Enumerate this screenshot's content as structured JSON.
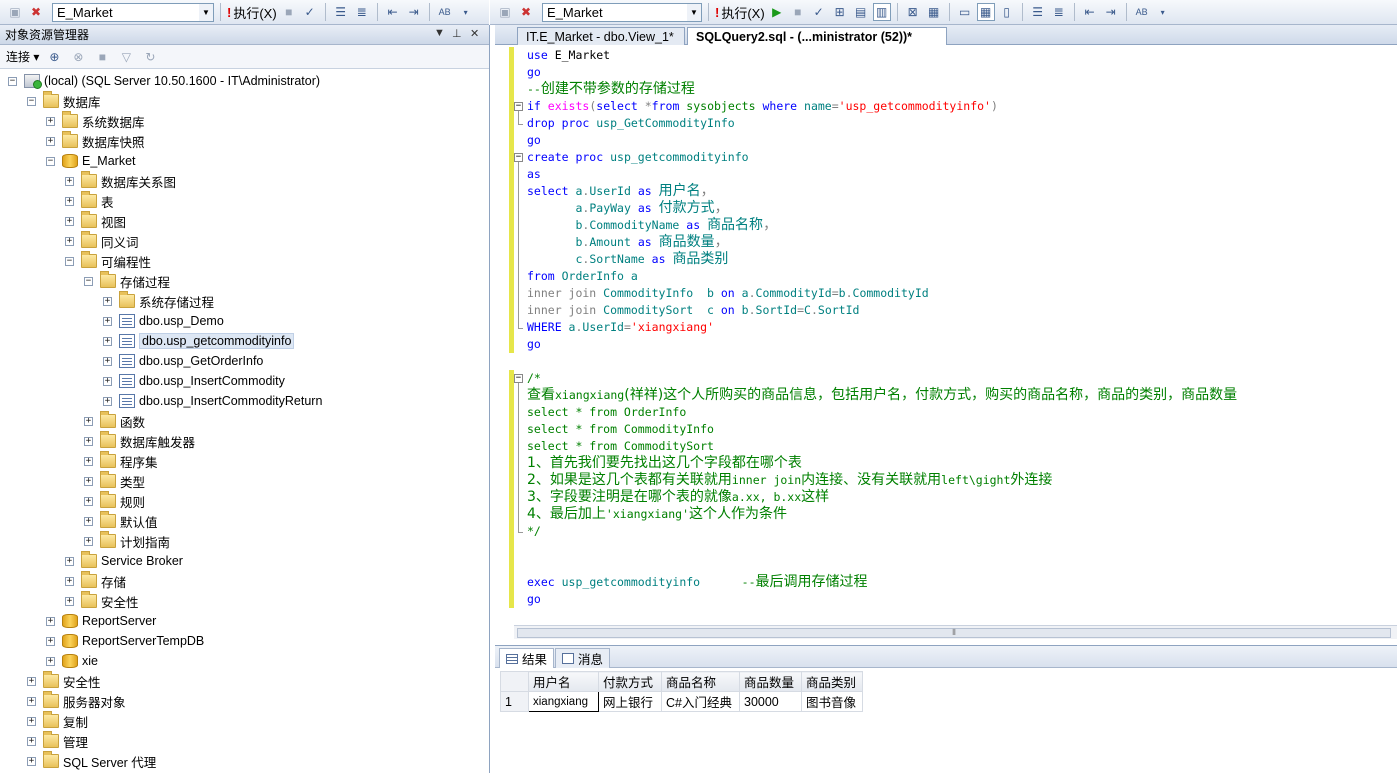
{
  "toolbar_left": {
    "database": "E_Market",
    "execute_label": "执行(X)"
  },
  "toolbar_right": {
    "database": "E_Market",
    "execute_label": "执行(X)"
  },
  "object_explorer": {
    "title": "对象资源管理器",
    "connect_label": "连接",
    "tree": [
      {
        "label": "(local) (SQL Server 10.50.1600 - IT\\Administrator)",
        "level": 0,
        "icon": "server-icon",
        "expanded": true
      },
      {
        "label": "数据库",
        "level": 1,
        "icon": "folder-icon",
        "expanded": true
      },
      {
        "label": "系统数据库",
        "level": 2,
        "icon": "folder-icon",
        "expanded": false
      },
      {
        "label": "数据库快照",
        "level": 2,
        "icon": "folder-icon",
        "expanded": false
      },
      {
        "label": "E_Market",
        "level": 2,
        "icon": "database-icon",
        "expanded": true
      },
      {
        "label": "数据库关系图",
        "level": 3,
        "icon": "folder-icon",
        "expanded": false
      },
      {
        "label": "表",
        "level": 3,
        "icon": "folder-icon",
        "expanded": false
      },
      {
        "label": "视图",
        "level": 3,
        "icon": "folder-icon",
        "expanded": false
      },
      {
        "label": "同义词",
        "level": 3,
        "icon": "folder-icon",
        "expanded": false
      },
      {
        "label": "可编程性",
        "level": 3,
        "icon": "folder-icon",
        "expanded": true
      },
      {
        "label": "存储过程",
        "level": 4,
        "icon": "folder-icon",
        "expanded": true
      },
      {
        "label": "系统存储过程",
        "level": 5,
        "icon": "folder-icon",
        "expanded": false
      },
      {
        "label": "dbo.usp_Demo",
        "level": 5,
        "icon": "procedure-icon",
        "expanded": false
      },
      {
        "label": "dbo.usp_getcommodityinfo",
        "level": 5,
        "icon": "procedure-icon",
        "expanded": false,
        "selected": true
      },
      {
        "label": "dbo.usp_GetOrderInfo",
        "level": 5,
        "icon": "procedure-icon",
        "expanded": false
      },
      {
        "label": "dbo.usp_InsertCommodity",
        "level": 5,
        "icon": "procedure-icon",
        "expanded": false
      },
      {
        "label": "dbo.usp_InsertCommodityReturn",
        "level": 5,
        "icon": "procedure-icon",
        "expanded": false
      },
      {
        "label": "函数",
        "level": 4,
        "icon": "folder-icon",
        "expanded": false
      },
      {
        "label": "数据库触发器",
        "level": 4,
        "icon": "folder-icon",
        "expanded": false
      },
      {
        "label": "程序集",
        "level": 4,
        "icon": "folder-icon",
        "expanded": false
      },
      {
        "label": "类型",
        "level": 4,
        "icon": "folder-icon",
        "expanded": false
      },
      {
        "label": "规则",
        "level": 4,
        "icon": "folder-icon",
        "expanded": false
      },
      {
        "label": "默认值",
        "level": 4,
        "icon": "folder-icon",
        "expanded": false
      },
      {
        "label": "计划指南",
        "level": 4,
        "icon": "folder-icon",
        "expanded": false
      },
      {
        "label": "Service Broker",
        "level": 3,
        "icon": "folder-icon",
        "expanded": false
      },
      {
        "label": "存储",
        "level": 3,
        "icon": "folder-icon",
        "expanded": false
      },
      {
        "label": "安全性",
        "level": 3,
        "icon": "folder-icon",
        "expanded": false
      },
      {
        "label": "ReportServer",
        "level": 2,
        "icon": "database-icon",
        "expanded": false
      },
      {
        "label": "ReportServerTempDB",
        "level": 2,
        "icon": "database-icon",
        "expanded": false
      },
      {
        "label": "xie",
        "level": 2,
        "icon": "database-icon",
        "expanded": false
      },
      {
        "label": "安全性",
        "level": 1,
        "icon": "folder-icon",
        "expanded": false
      },
      {
        "label": "服务器对象",
        "level": 1,
        "icon": "folder-icon",
        "expanded": false
      },
      {
        "label": "复制",
        "level": 1,
        "icon": "folder-icon",
        "expanded": false
      },
      {
        "label": "管理",
        "level": 1,
        "icon": "folder-icon",
        "expanded": false
      },
      {
        "label": "SQL Server 代理",
        "level": 1,
        "icon": "folder-icon",
        "expanded": false
      }
    ]
  },
  "editor": {
    "tabs": [
      {
        "label": "IT.E_Market - dbo.View_1*",
        "active": false
      },
      {
        "label": "SQLQuery2.sql - (...ministrator (52))*",
        "active": true
      }
    ],
    "lines": [
      {
        "fold": "",
        "parts": [
          [
            "kw",
            "use "
          ],
          [
            "",
            "E_Market"
          ]
        ]
      },
      {
        "fold": "",
        "parts": [
          [
            "kw",
            "go"
          ]
        ]
      },
      {
        "fold": "",
        "parts": [
          [
            "cm",
            "--"
          ],
          [
            "cm cn",
            "创建不带参数的存储过程"
          ]
        ]
      },
      {
        "fold": "minus",
        "parts": [
          [
            "kw",
            "if "
          ],
          [
            "fn",
            "exists"
          ],
          [
            "gr",
            "("
          ],
          [
            "kw",
            "select "
          ],
          [
            "gr",
            "*"
          ],
          [
            "kw",
            "from "
          ],
          [
            "sys",
            "sysobjects "
          ],
          [
            "kw",
            "where "
          ],
          [
            "tl",
            "name"
          ],
          [
            "gr",
            "="
          ],
          [
            "str",
            "'usp_getcommodityinfo'"
          ],
          [
            "gr",
            ")"
          ]
        ]
      },
      {
        "fold": "end",
        "parts": [
          [
            "kw",
            "drop proc "
          ],
          [
            "tl",
            "usp_GetCommodityInfo"
          ]
        ]
      },
      {
        "fold": "",
        "parts": [
          [
            "kw",
            "go"
          ]
        ]
      },
      {
        "fold": "minus",
        "parts": [
          [
            "kw",
            "create proc "
          ],
          [
            "tl",
            "usp_getcommodityinfo"
          ]
        ]
      },
      {
        "fold": "",
        "parts": [
          [
            "kw",
            "as"
          ]
        ]
      },
      {
        "fold": "",
        "parts": [
          [
            "kw",
            "select "
          ],
          [
            "tl",
            "a"
          ],
          [
            "gr",
            "."
          ],
          [
            "tl",
            "UserId "
          ],
          [
            "kw",
            "as "
          ],
          [
            "tl cn",
            "用户名"
          ],
          [
            "gr cn",
            "，"
          ]
        ]
      },
      {
        "fold": "",
        "parts": [
          [
            "",
            "       "
          ],
          [
            "tl",
            "a"
          ],
          [
            "gr",
            "."
          ],
          [
            "tl",
            "PayWay "
          ],
          [
            "kw",
            "as "
          ],
          [
            "tl cn",
            "付款方式"
          ],
          [
            "gr cn",
            "，"
          ]
        ]
      },
      {
        "fold": "",
        "parts": [
          [
            "",
            "       "
          ],
          [
            "tl",
            "b"
          ],
          [
            "gr",
            "."
          ],
          [
            "tl",
            "CommodityName "
          ],
          [
            "kw",
            "as "
          ],
          [
            "tl cn",
            "商品名称"
          ],
          [
            "gr cn",
            "，"
          ]
        ]
      },
      {
        "fold": "",
        "parts": [
          [
            "",
            "       "
          ],
          [
            "tl",
            "b"
          ],
          [
            "gr",
            "."
          ],
          [
            "tl",
            "Amount "
          ],
          [
            "kw",
            "as "
          ],
          [
            "tl cn",
            "商品数量"
          ],
          [
            "gr cn",
            "，"
          ]
        ]
      },
      {
        "fold": "",
        "parts": [
          [
            "",
            "       "
          ],
          [
            "tl",
            "c"
          ],
          [
            "gr",
            "."
          ],
          [
            "tl",
            "SortName "
          ],
          [
            "kw",
            "as "
          ],
          [
            "tl cn",
            "商品类别"
          ]
        ]
      },
      {
        "fold": "",
        "parts": [
          [
            "kw",
            "from "
          ],
          [
            "tl",
            "OrderInfo a"
          ]
        ]
      },
      {
        "fold": "",
        "parts": [
          [
            "gr",
            "inner join "
          ],
          [
            "tl",
            "CommodityInfo  b "
          ],
          [
            "kw",
            "on "
          ],
          [
            "tl",
            "a"
          ],
          [
            "gr",
            "."
          ],
          [
            "tl",
            "CommodityId"
          ],
          [
            "gr",
            "="
          ],
          [
            "tl",
            "b"
          ],
          [
            "gr",
            "."
          ],
          [
            "tl",
            "CommodityId"
          ]
        ]
      },
      {
        "fold": "",
        "parts": [
          [
            "gr",
            "inner join "
          ],
          [
            "tl",
            "CommoditySort  c "
          ],
          [
            "kw",
            "on "
          ],
          [
            "tl",
            "b"
          ],
          [
            "gr",
            "."
          ],
          [
            "tl",
            "SortId"
          ],
          [
            "gr",
            "="
          ],
          [
            "tl",
            "C"
          ],
          [
            "gr",
            "."
          ],
          [
            "tl",
            "SortId"
          ]
        ]
      },
      {
        "fold": "end",
        "parts": [
          [
            "kw",
            "WHERE "
          ],
          [
            "tl",
            "a"
          ],
          [
            "gr",
            "."
          ],
          [
            "tl",
            "UserId"
          ],
          [
            "gr",
            "="
          ],
          [
            "str",
            "'xiangxiang'"
          ]
        ]
      },
      {
        "fold": "",
        "parts": [
          [
            "kw",
            "go"
          ]
        ]
      },
      {
        "fold": "",
        "parts": []
      },
      {
        "fold": "minus",
        "parts": [
          [
            "cm",
            "/*"
          ]
        ]
      },
      {
        "fold": "",
        "parts": [
          [
            "cm cn",
            "查看"
          ],
          [
            "cm",
            "xiangxiang"
          ],
          [
            "cm cn",
            "(祥祥)这个人所购买的商品信息，包括用户名，付款方式，购买的商品名称，商品的类别，商品数量"
          ]
        ]
      },
      {
        "fold": "",
        "parts": [
          [
            "cm",
            "select * from OrderInfo"
          ]
        ]
      },
      {
        "fold": "",
        "parts": [
          [
            "cm",
            "select * from CommodityInfo"
          ]
        ]
      },
      {
        "fold": "",
        "parts": [
          [
            "cm",
            "select * from CommoditySort"
          ]
        ]
      },
      {
        "fold": "",
        "parts": [
          [
            "cm cn",
            "1、首先我们要先找出这几个字段都在哪个表"
          ]
        ]
      },
      {
        "fold": "",
        "parts": [
          [
            "cm cn",
            "2、如果是这几个表都有关联就用"
          ],
          [
            "cm",
            "inner join"
          ],
          [
            "cm cn",
            "内连接、没有关联就用"
          ],
          [
            "cm",
            "left\\gight"
          ],
          [
            "cm cn",
            "外连接"
          ]
        ]
      },
      {
        "fold": "",
        "parts": [
          [
            "cm cn",
            "3、字段要注明是在哪个表的就像"
          ],
          [
            "cm",
            "a.xx, b.xx"
          ],
          [
            "cm cn",
            "这样"
          ]
        ]
      },
      {
        "fold": "",
        "parts": [
          [
            "cm cn",
            "4、最后加上"
          ],
          [
            "cm",
            "'xiangxiang'"
          ],
          [
            "cm cn",
            "这个人作为条件"
          ]
        ]
      },
      {
        "fold": "end",
        "parts": [
          [
            "cm",
            "*/"
          ]
        ]
      },
      {
        "fold": "",
        "parts": []
      },
      {
        "fold": "",
        "parts": []
      },
      {
        "fold": "",
        "parts": [
          [
            "kw",
            "exec "
          ],
          [
            "tl",
            "usp_getcommodityinfo      "
          ],
          [
            "cm",
            "--"
          ],
          [
            "cm cn",
            "最后调用存储过程"
          ]
        ]
      },
      {
        "fold": "",
        "parts": [
          [
            "kw",
            "go"
          ]
        ]
      }
    ]
  },
  "results": {
    "tabs": [
      {
        "label": "结果",
        "icon": "grid-icon",
        "active": true
      },
      {
        "label": "消息",
        "icon": "message-icon",
        "active": false
      }
    ],
    "columns": [
      "用户名",
      "付款方式",
      "商品名称",
      "商品数量",
      "商品类别"
    ],
    "rows": [
      {
        "num": "1",
        "cells": [
          "xiangxiang",
          "网上银行",
          "C#入门经典",
          "30000",
          "图书音像"
        ]
      }
    ]
  }
}
